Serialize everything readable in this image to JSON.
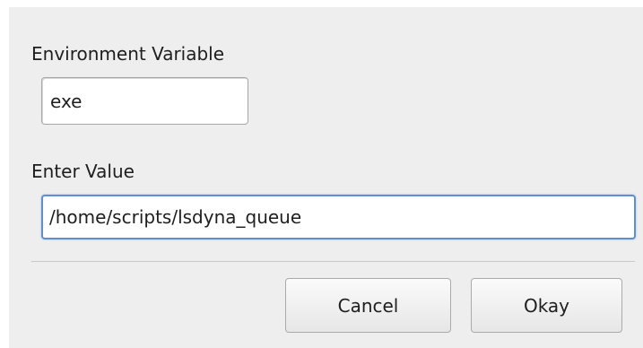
{
  "dialog": {
    "env_label": "Environment Variable",
    "env_value": "exe",
    "value_label": "Enter Value",
    "value_value": "/home/scripts/lsdyna_queue",
    "cancel_label": "Cancel",
    "okay_label": "Okay"
  },
  "colors": {
    "background": "#eeeeee",
    "focus_border": "#5f8fd0"
  }
}
